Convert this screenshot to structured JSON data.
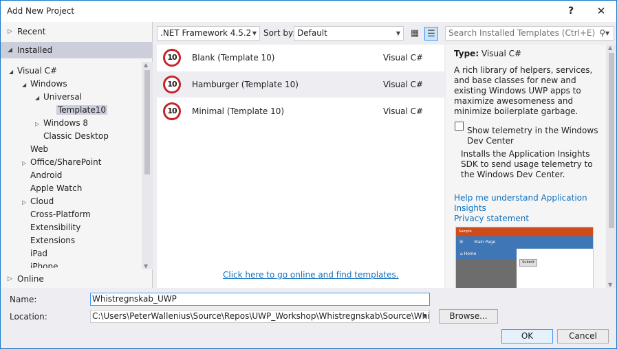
{
  "window": {
    "title": "Add New Project",
    "help_icon": "?",
    "close_icon": "✕"
  },
  "left": {
    "recent": "Recent",
    "installed": "Installed",
    "online": "Online",
    "tree": [
      {
        "label": "Visual C#",
        "arrow": "◢"
      },
      {
        "label": "Windows",
        "arrow": "◢"
      },
      {
        "label": "Universal",
        "arrow": "◢"
      },
      {
        "label": "Template10",
        "arrow": ""
      },
      {
        "label": "Windows 8",
        "arrow": "▷"
      },
      {
        "label": "Classic Desktop",
        "arrow": ""
      },
      {
        "label": "Web",
        "arrow": ""
      },
      {
        "label": "Office/SharePoint",
        "arrow": "▷"
      },
      {
        "label": "Android",
        "arrow": ""
      },
      {
        "label": "Apple Watch",
        "arrow": ""
      },
      {
        "label": "Cloud",
        "arrow": "▷"
      },
      {
        "label": "Cross-Platform",
        "arrow": ""
      },
      {
        "label": "Extensibility",
        "arrow": ""
      },
      {
        "label": "Extensions",
        "arrow": ""
      },
      {
        "label": "iPad",
        "arrow": ""
      },
      {
        "label": "iPhone",
        "arrow": ""
      }
    ]
  },
  "toolbar": {
    "framework": ".NET Framework 4.5.2",
    "sort_label": "Sort by:",
    "sort_value": "Default",
    "search_placeholder": "Search Installed Templates (Ctrl+E)"
  },
  "templates": [
    {
      "badge": "10",
      "name": "Blank (Template 10)",
      "lang": "Visual C#"
    },
    {
      "badge": "10",
      "name": "Hamburger (Template 10)",
      "lang": "Visual C#"
    },
    {
      "badge": "10",
      "name": "Minimal (Template 10)",
      "lang": "Visual C#"
    }
  ],
  "online_link": "Click here to go online and find templates.",
  "detail": {
    "type_label": "Type:",
    "type_value": "Visual C#",
    "description": "A rich library of helpers, services, and base classes for new and existing Windows UWP apps to maximize awesomeness and minimize boilerplate garbage.",
    "telemetry_label": "Show telemetry in the Windows Dev Center",
    "telemetry_desc": "Installs the Application Insights SDK to send usage telemetry to the Windows Dev Center.",
    "help_link": "Help me understand Application Insights",
    "privacy_link": "Privacy statement",
    "preview": {
      "app_title": "Sample",
      "page_title": "Main Page",
      "nav_item": "Home",
      "button": "Submit"
    }
  },
  "bottom": {
    "name_label": "Name:",
    "name_value": "Whistregnskab_UWP",
    "location_label": "Location:",
    "location_value": "C:\\Users\\PeterWallenius\\Source\\Repos\\UWP_Workshop\\Whistregnskab\\Source\\Whistregnskab",
    "browse": "Browse...",
    "ok": "OK",
    "cancel": "Cancel"
  }
}
